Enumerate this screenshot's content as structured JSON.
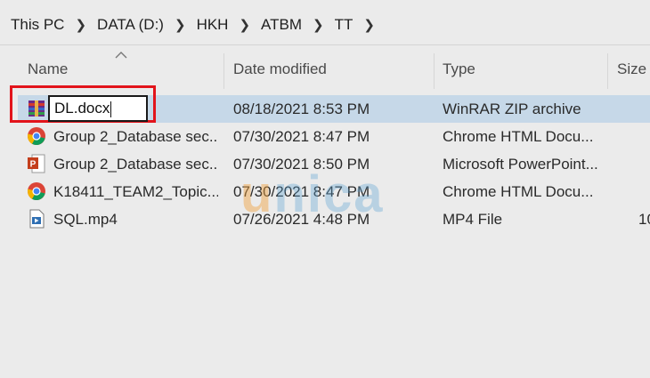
{
  "breadcrumb": {
    "items": [
      "This PC",
      "DATA (D:)",
      "HKH",
      "ATBM",
      "TT"
    ]
  },
  "columns": {
    "name": "Name",
    "date_modified": "Date modified",
    "type": "Type",
    "size": "Size"
  },
  "rename": {
    "value": "DL.docx"
  },
  "files": [
    {
      "name": "",
      "date": "08/18/2021 8:53 PM",
      "type": "WinRAR ZIP archive",
      "size": "",
      "icon": "winrar-icon"
    },
    {
      "name": "Group 2_Database sec...",
      "date": "07/30/2021 8:47 PM",
      "type": "Chrome HTML Docu...",
      "size": "",
      "icon": "chrome-icon"
    },
    {
      "name": "Group 2_Database sec...",
      "date": "07/30/2021 8:50 PM",
      "type": "Microsoft PowerPoint...",
      "size": "",
      "icon": "powerpoint-icon"
    },
    {
      "name": "K18411_TEAM2_Topic...",
      "date": "07/30/2021 8:47 PM",
      "type": "Chrome HTML Docu...",
      "size": "",
      "icon": "chrome-icon"
    },
    {
      "name": "SQL.mp4",
      "date": "07/26/2021 4:48 PM",
      "type": "MP4 File",
      "size": "10",
      "icon": "mp4-icon"
    }
  ],
  "watermark": {
    "u": "u",
    "rest": "nica"
  },
  "colors": {
    "highlight": "#e2141b",
    "selection": "#c6d8e8"
  }
}
